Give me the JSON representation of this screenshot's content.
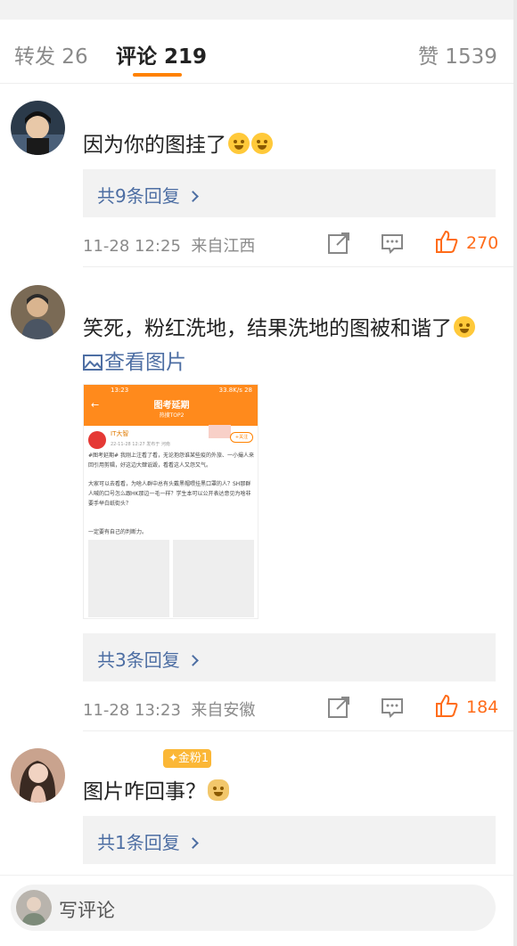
{
  "tabs": {
    "repost": "转发 26",
    "comments": "评论 219",
    "likes": "赞 1539"
  },
  "comments": [
    {
      "text": "因为你的图挂了",
      "reply_link": "共9条回复",
      "time": "11-28 12:25",
      "source": "来自江西",
      "likes": "270"
    },
    {
      "text": "笑死，粉红洗地，结果洗地的图被和谐了",
      "view_image": "查看图片",
      "reply_link": "共3条回复",
      "time": "11-28 13:23",
      "source": "来自安徽",
      "likes": "184",
      "embedded": {
        "status_time": "13:23",
        "status_right": "33.8K/s 28",
        "title": "图考延期",
        "subtitle": "热搜TOP2",
        "author": "IT大智",
        "date": "22-11-28 12:27  发布于 河南",
        "follow": "+关注",
        "para1": "#图考延期# 我刚上注看了看，无论抱怨谁某些疫的外旅、一小撮人来回引用剪辑，好这边大肆诋毁，看看这人又怨又气。",
        "para2": "大家可以去看看，为啥人群中总有头戴黑帽喂挂黑口罩的人？SH那群人喊的口号怎么跟HK那边一毛一样？学生本可以公开表达意见为啥非要手举白纸街头？",
        "para3": "一定要有自己的判断力。"
      }
    },
    {
      "badge": "金粉1",
      "text": "图片咋回事？",
      "reply_link": "共1条回复"
    }
  ],
  "composer": {
    "placeholder": "写评论"
  },
  "colors": {
    "accent": "#ff8200",
    "link": "#4d6ea3",
    "like": "#ff6c1a"
  }
}
